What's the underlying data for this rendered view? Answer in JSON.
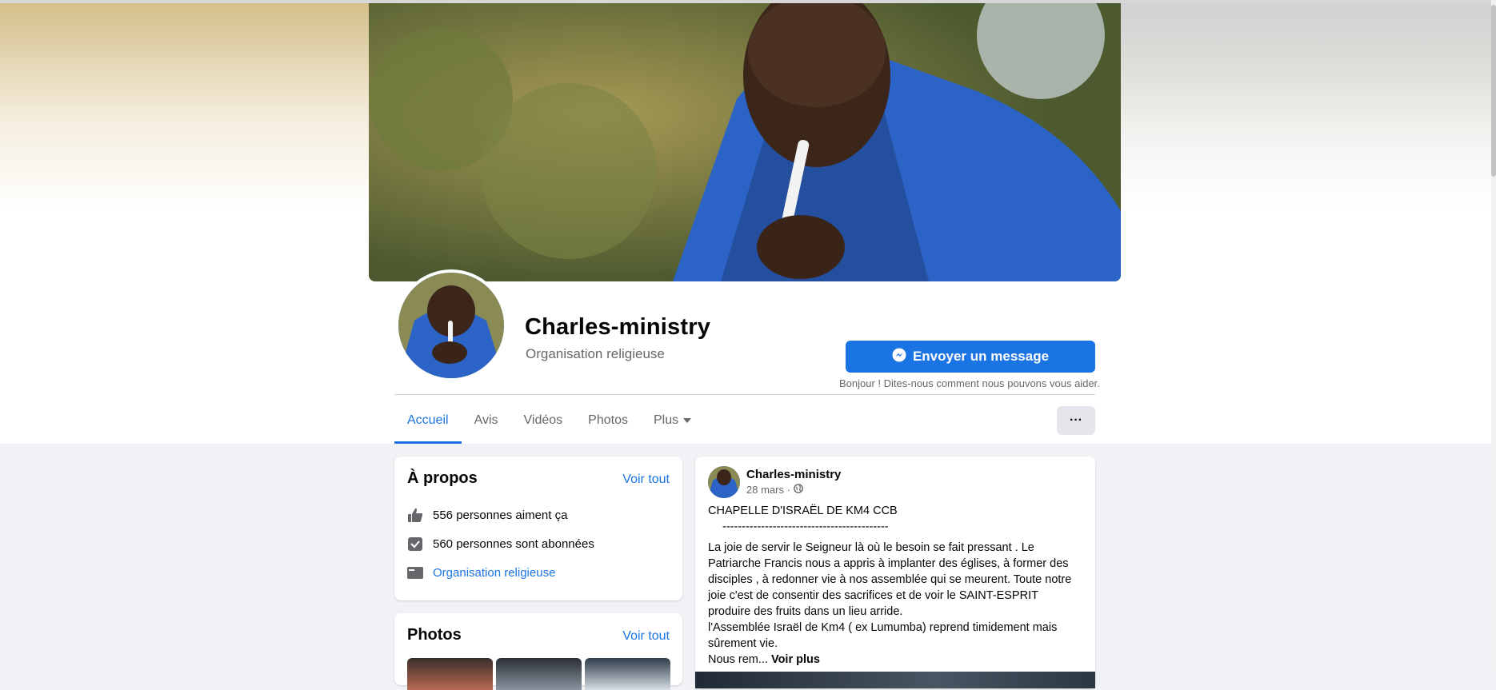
{
  "page": {
    "name": "Charles-ministry",
    "category": "Organisation religieuse"
  },
  "actions": {
    "message_button": "Envoyer un message",
    "message_hint": "Bonjour ! Dites-nous comment nous pouvons vous aider.",
    "more_button": "···"
  },
  "tabs": [
    {
      "label": "Accueil",
      "active": true
    },
    {
      "label": "Avis",
      "active": false
    },
    {
      "label": "Vidéos",
      "active": false
    },
    {
      "label": "Photos",
      "active": false
    },
    {
      "label": "Plus",
      "active": false
    }
  ],
  "about": {
    "title": "À propos",
    "see_all": "Voir tout",
    "likes": "556 personnes aiment ça",
    "followers": "560 personnes sont abonnées",
    "category_link": "Organisation religieuse"
  },
  "photos": {
    "title": "Photos",
    "see_all": "Voir tout"
  },
  "post": {
    "author": "Charles-ministry",
    "date": "28 mars ·",
    "line1": "CHAPELLE D'ISRAËL DE KM4 CCB",
    "line2": "-------------------------------------------",
    "paragraph": "La joie de servir le Seigneur là où le besoin se fait pressant . Le Patriarche Francis  nous a appris à implanter des églises, à former des disciples , à redonner vie à nos assemblée qui se meurent. Toute notre joie c'est de consentir des sacrifices et de voir le SAINT-ESPRIT produire des fruits dans un lieu arride.",
    "paragraph2": "l'Assemblée Israël de Km4 ( ex Lumumba) reprend timidement mais sûrement vie.",
    "truncated": "Nous rem...",
    "see_more": "Voir plus"
  },
  "colors": {
    "accent": "#1b74e4",
    "background": "#f0f2f5",
    "secondary_text": "#65676b"
  },
  "icons": [
    "messenger-icon",
    "thumbs-up-icon",
    "follow-check-icon",
    "category-icon",
    "globe-icon",
    "caret-down-icon"
  ]
}
